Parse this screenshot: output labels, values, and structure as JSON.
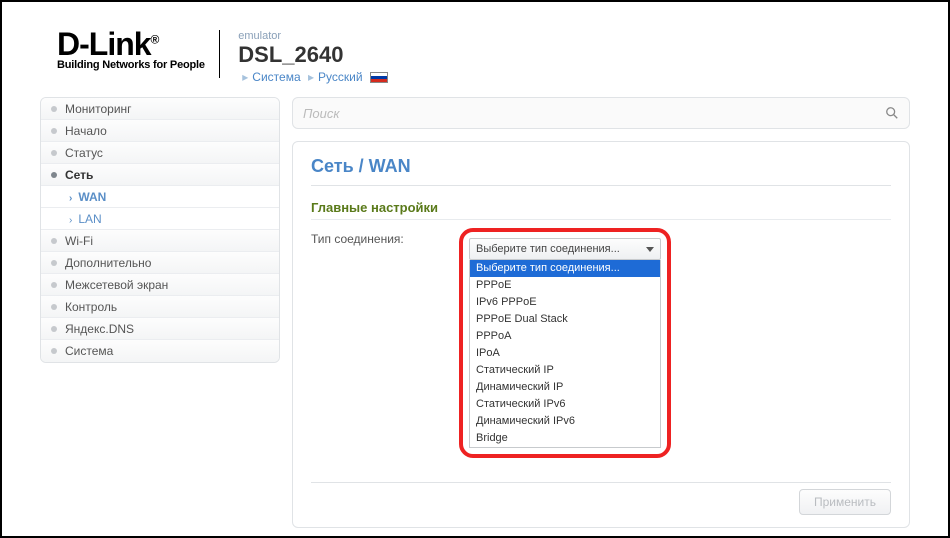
{
  "header": {
    "logo_main": "D-Link",
    "logo_sub": "Building Networks for People",
    "emulator": "emulator",
    "model": "DSL_2640",
    "crumb_system": "Система",
    "crumb_lang": "Русский"
  },
  "sidebar": {
    "items": [
      {
        "label": "Мониторинг",
        "open": false
      },
      {
        "label": "Начало",
        "open": false
      },
      {
        "label": "Статус",
        "open": false
      },
      {
        "label": "Сеть",
        "open": true,
        "sub": [
          {
            "label": "WAN",
            "active": true
          },
          {
            "label": "LAN",
            "active": false
          }
        ]
      },
      {
        "label": "Wi-Fi",
        "open": false
      },
      {
        "label": "Дополнительно",
        "open": false
      },
      {
        "label": "Межсетевой экран",
        "open": false
      },
      {
        "label": "Контроль",
        "open": false
      },
      {
        "label": "Яндекс.DNS",
        "open": false
      },
      {
        "label": "Система",
        "open": false
      }
    ]
  },
  "search": {
    "placeholder": "Поиск"
  },
  "main": {
    "title": "Сеть /  WAN",
    "section": "Главные настройки",
    "field_label": "Тип соединения:",
    "select_value": "Выберите тип соединения...",
    "options": [
      "Выберите тип соединения...",
      "PPPoE",
      "IPv6 PPPoE",
      "PPPoE Dual Stack",
      "PPPoA",
      "IPoA",
      "Статический IP",
      "Динамический IP",
      "Статический IPv6",
      "Динамический IPv6",
      "Bridge"
    ],
    "apply": "Применить"
  }
}
